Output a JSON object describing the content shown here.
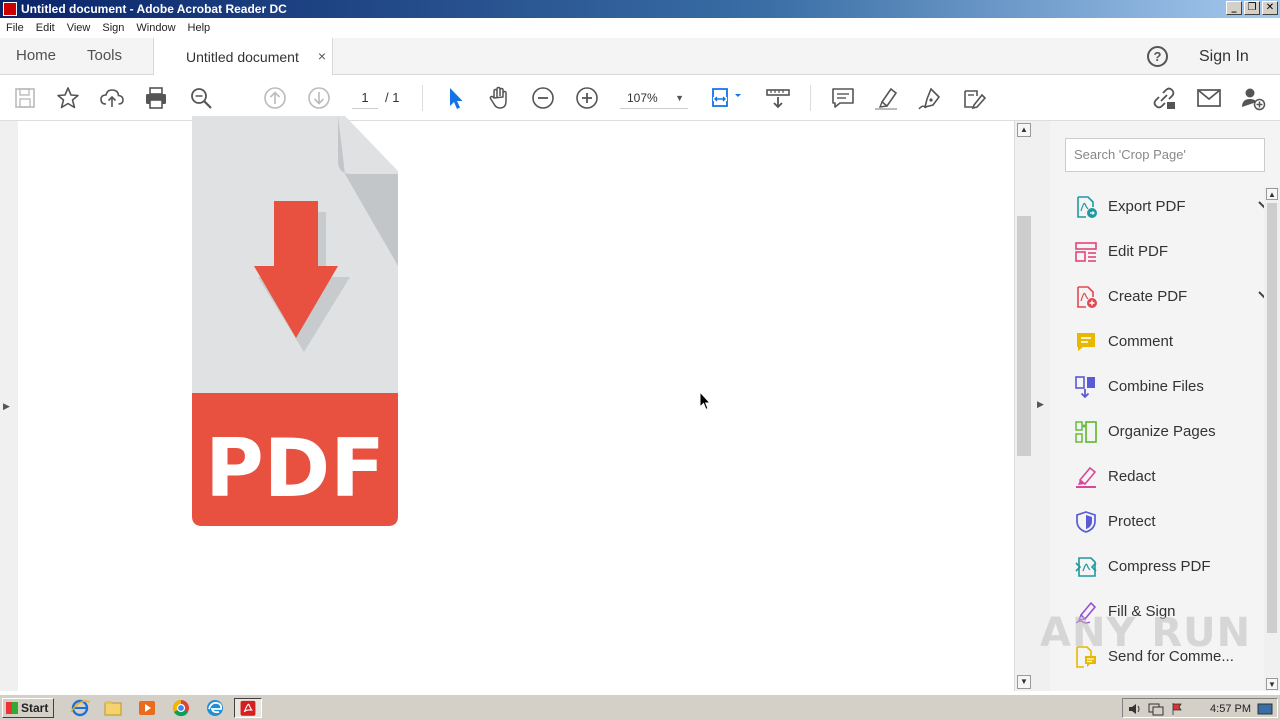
{
  "window": {
    "title": "Untitled document - Adobe Acrobat Reader DC",
    "buttons": [
      "_",
      "❐",
      "✕"
    ]
  },
  "menu": [
    "File",
    "Edit",
    "View",
    "Sign",
    "Window",
    "Help"
  ],
  "tabs": {
    "home": "Home",
    "tools": "Tools",
    "document": "Untitled document",
    "close": "×",
    "help": "?",
    "sign_in": "Sign In"
  },
  "toolbar": {
    "page_current": "1",
    "page_total": "/ 1",
    "zoom": "107%",
    "icons": [
      "save-icon",
      "bookmark-star-icon",
      "upload-cloud-icon",
      "print-icon",
      "zoom-search-icon",
      "page-up-icon",
      "page-down-icon",
      "select-arrow-icon",
      "hand-icon",
      "zoom-out-icon",
      "zoom-in-icon",
      "fit-page-icon",
      "scroll-mode-icon",
      "comment-icon",
      "highlight-icon",
      "sign-icon",
      "fill-sign-icon",
      "share-link-icon",
      "email-icon",
      "add-user-icon"
    ]
  },
  "document": {
    "graphic_text": "PDF",
    "colors": {
      "paper": "#dfe1e3",
      "fold": "#c3c6c9",
      "accent": "#e8503f",
      "shadow": "#b9bcbf"
    }
  },
  "tools_pane": {
    "search_placeholder": "Search 'Crop Page'",
    "items": [
      {
        "label": "Export PDF",
        "icon": "export-pdf-icon",
        "color": "#1e9aa0",
        "dropdown": true
      },
      {
        "label": "Edit PDF",
        "icon": "edit-pdf-icon",
        "color": "#e0457b",
        "dropdown": false
      },
      {
        "label": "Create PDF",
        "icon": "create-pdf-icon",
        "color": "#e34850",
        "dropdown": true
      },
      {
        "label": "Comment",
        "icon": "comment-icon",
        "color": "#e8b800",
        "dropdown": false
      },
      {
        "label": "Combine Files",
        "icon": "combine-files-icon",
        "color": "#5a5ad6",
        "dropdown": false
      },
      {
        "label": "Organize Pages",
        "icon": "organize-pages-icon",
        "color": "#5cb82f",
        "dropdown": false
      },
      {
        "label": "Redact",
        "icon": "redact-icon",
        "color": "#d9479a",
        "dropdown": false
      },
      {
        "label": "Protect",
        "icon": "protect-icon",
        "color": "#5a5ad6",
        "dropdown": false
      },
      {
        "label": "Compress PDF",
        "icon": "compress-pdf-icon",
        "color": "#1e9aa0",
        "dropdown": false
      },
      {
        "label": "Fill & Sign",
        "icon": "fill-sign-icon",
        "color": "#9b4fd6",
        "dropdown": false
      },
      {
        "label": "Send for Comme...",
        "icon": "send-for-comment-icon",
        "color": "#e8b800",
        "dropdown": false
      }
    ]
  },
  "watermark": "ANY RUN",
  "taskbar": {
    "start": "Start",
    "apps": [
      "ie-icon",
      "explorer-icon",
      "media-player-icon",
      "chrome-icon",
      "edge-icon",
      "acrobat-icon"
    ],
    "clock": "4:57 PM"
  }
}
